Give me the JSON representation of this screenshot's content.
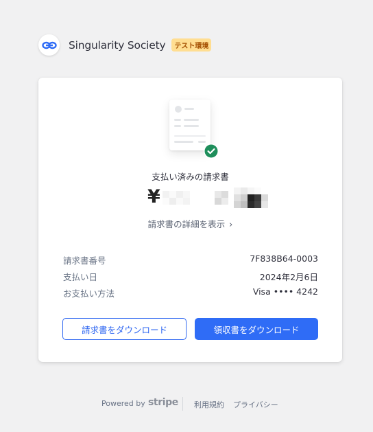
{
  "header": {
    "company_name": "Singularity Society",
    "test_badge": "テスト環境",
    "logo_icon": "infinity-logo-icon",
    "accent_color": "#2f6cf6"
  },
  "receipt": {
    "status_title": "支払い済みの請求書",
    "amount_prefix": "¥",
    "amount_obscured": true,
    "details_link": "請求書の詳細を表示",
    "details_chevron": "›",
    "status_icon": "check-circle-icon",
    "status_color": "#1e8e5b"
  },
  "details": [
    {
      "label": "請求書番号",
      "value": "7F838B64-0003"
    },
    {
      "label": "支払い日",
      "value": "2024年2月6日"
    },
    {
      "label": "お支払い方法",
      "value": "Visa •••• 4242"
    }
  ],
  "actions": {
    "download_invoice": "請求書をダウンロード",
    "download_receipt": "領収書をダウンロード"
  },
  "footer": {
    "powered_by": "Powered by",
    "brand": "stripe",
    "terms": "利用規約",
    "privacy": "プライバシー"
  }
}
